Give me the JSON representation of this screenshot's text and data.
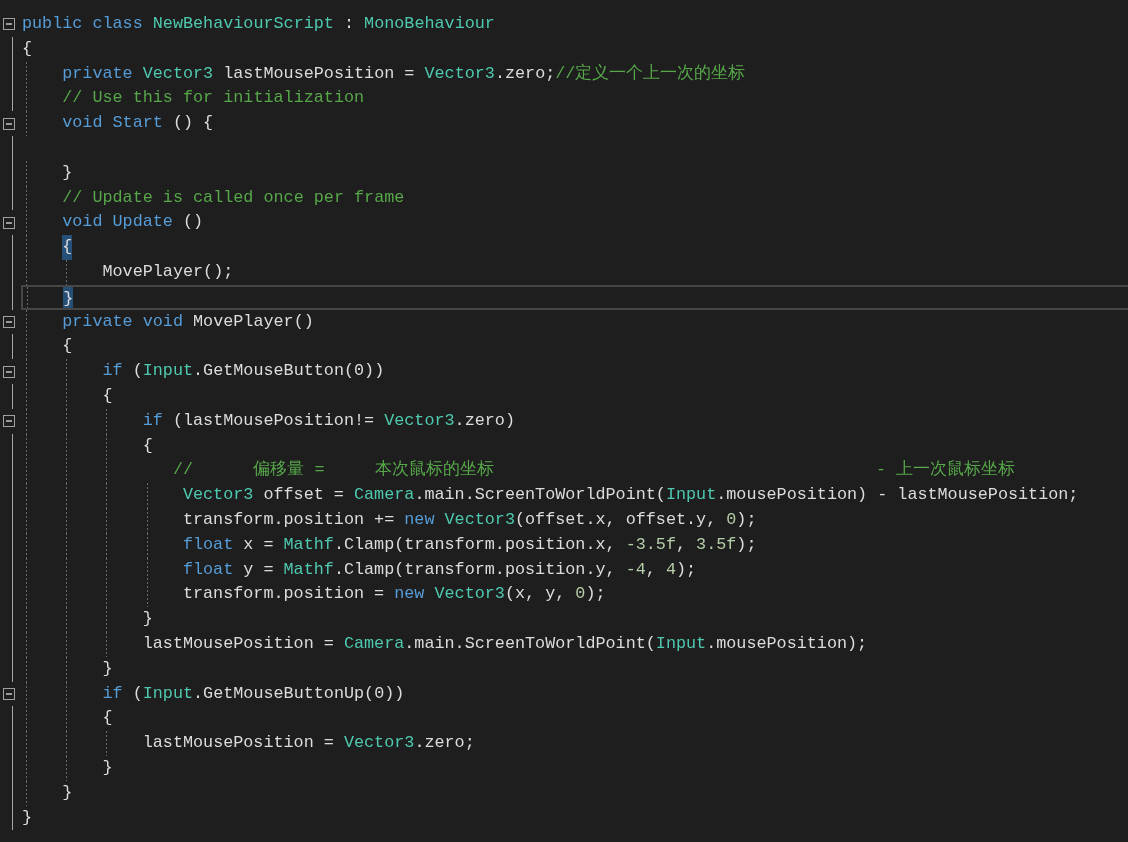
{
  "editor": {
    "lines": [
      {
        "foldable": true,
        "current": false,
        "brace_match": false,
        "tokens": [
          {
            "kind": "kw",
            "text": "public class "
          },
          {
            "kind": "type",
            "text": "NewBehaviourScript"
          },
          {
            "kind": "plain",
            "text": " : "
          },
          {
            "kind": "type",
            "text": "MonoBehaviour"
          }
        ]
      },
      {
        "foldable": false,
        "current": false,
        "brace_match": false,
        "tokens": [
          {
            "kind": "plain",
            "text": "{"
          }
        ]
      },
      {
        "foldable": false,
        "current": false,
        "brace_match": false,
        "tokens": [
          {
            "kind": "kw",
            "text": "    private "
          },
          {
            "kind": "type",
            "text": "Vector3"
          },
          {
            "kind": "plain",
            "text": " lastMousePosition = "
          },
          {
            "kind": "type",
            "text": "Vector3"
          },
          {
            "kind": "plain",
            "text": ".zero;"
          },
          {
            "kind": "comment",
            "text": "//定义一个上一次的坐标"
          }
        ]
      },
      {
        "foldable": false,
        "current": false,
        "brace_match": false,
        "tokens": [
          {
            "kind": "comment",
            "text": "    // Use this for initialization"
          }
        ]
      },
      {
        "foldable": true,
        "current": false,
        "brace_match": false,
        "tokens": [
          {
            "kind": "kw",
            "text": "    void "
          },
          {
            "kind": "fn",
            "text": "Start"
          },
          {
            "kind": "plain",
            "text": " () {"
          }
        ]
      },
      {
        "foldable": false,
        "current": false
      },
      {
        "foldable": false,
        "current": false,
        "brace_match": false,
        "tokens": [
          {
            "kind": "plain",
            "text": "    }"
          }
        ]
      },
      {
        "foldable": false,
        "current": false,
        "brace_match": false,
        "tokens": [
          {
            "kind": "comment",
            "text": "    // Update is called once per frame"
          }
        ]
      },
      {
        "foldable": true,
        "current": false,
        "brace_match": false,
        "tokens": [
          {
            "kind": "kw",
            "text": "    void "
          },
          {
            "kind": "fn",
            "text": "Update"
          },
          {
            "kind": "plain",
            "text": " ()"
          }
        ]
      },
      {
        "foldable": false,
        "current": false,
        "brace_match": true,
        "tokens": [
          {
            "kind": "plain",
            "text": "    {"
          }
        ]
      },
      {
        "foldable": false,
        "current": false,
        "brace_match": false,
        "tokens": [
          {
            "kind": "plain",
            "text": "        MovePlayer();"
          }
        ]
      },
      {
        "foldable": false,
        "current": true,
        "brace_match": true,
        "tokens": [
          {
            "kind": "plain",
            "text": "    }"
          }
        ]
      },
      {
        "foldable": true,
        "current": false,
        "brace_match": false,
        "tokens": [
          {
            "kind": "kw",
            "text": "    private void "
          },
          {
            "kind": "plain",
            "text": "MovePlayer()"
          }
        ]
      },
      {
        "foldable": false,
        "current": false,
        "brace_match": false,
        "tokens": [
          {
            "kind": "plain",
            "text": "    {"
          }
        ]
      },
      {
        "foldable": true,
        "current": false,
        "brace_match": false,
        "tokens": [
          {
            "kind": "kw",
            "text": "        if"
          },
          {
            "kind": "plain",
            "text": " ("
          },
          {
            "kind": "type",
            "text": "Input"
          },
          {
            "kind": "plain",
            "text": ".GetMouseButton(0))"
          }
        ]
      },
      {
        "foldable": false,
        "current": false,
        "brace_match": false,
        "tokens": [
          {
            "kind": "plain",
            "text": "        {"
          }
        ]
      },
      {
        "foldable": true,
        "current": false,
        "brace_match": false,
        "tokens": [
          {
            "kind": "kw",
            "text": "            if"
          },
          {
            "kind": "plain",
            "text": " (lastMousePosition!= "
          },
          {
            "kind": "type",
            "text": "Vector3"
          },
          {
            "kind": "plain",
            "text": ".zero)"
          }
        ]
      },
      {
        "foldable": false,
        "current": false,
        "brace_match": false,
        "tokens": [
          {
            "kind": "plain",
            "text": "            {"
          }
        ]
      },
      {
        "foldable": false,
        "current": false,
        "brace_match": false,
        "tokens": [
          {
            "kind": "comment",
            "text": "               //      偏移量 =     本次鼠标的坐标                                      - 上一次鼠标坐标"
          }
        ]
      },
      {
        "foldable": false,
        "current": false,
        "brace_match": false,
        "tokens": [
          {
            "kind": "type",
            "text": "                Vector3"
          },
          {
            "kind": "plain",
            "text": " offset = "
          },
          {
            "kind": "type",
            "text": "Camera"
          },
          {
            "kind": "plain",
            "text": ".main.ScreenToWorldPoint("
          },
          {
            "kind": "type",
            "text": "Input"
          },
          {
            "kind": "plain",
            "text": ".mousePosition) - lastMousePosition;"
          }
        ]
      },
      {
        "foldable": false,
        "current": false,
        "brace_match": false,
        "tokens": [
          {
            "kind": "plain",
            "text": "                transform.position += "
          },
          {
            "kind": "kw",
            "text": "new "
          },
          {
            "kind": "type",
            "text": "Vector3"
          },
          {
            "kind": "plain",
            "text": "(offset.x, offset.y, "
          },
          {
            "kind": "num",
            "text": "0"
          },
          {
            "kind": "plain",
            "text": ");"
          }
        ]
      },
      {
        "foldable": false,
        "current": false,
        "brace_match": false,
        "tokens": [
          {
            "kind": "kw",
            "text": "                float"
          },
          {
            "kind": "plain",
            "text": " x = "
          },
          {
            "kind": "type",
            "text": "Mathf"
          },
          {
            "kind": "plain",
            "text": ".Clamp(transform.position.x, "
          },
          {
            "kind": "num",
            "text": "-3.5f"
          },
          {
            "kind": "plain",
            "text": ", "
          },
          {
            "kind": "num",
            "text": "3.5f"
          },
          {
            "kind": "plain",
            "text": ");"
          }
        ]
      },
      {
        "foldable": false,
        "current": false,
        "brace_match": false,
        "tokens": [
          {
            "kind": "kw",
            "text": "                float"
          },
          {
            "kind": "plain",
            "text": " y = "
          },
          {
            "kind": "type",
            "text": "Mathf"
          },
          {
            "kind": "plain",
            "text": ".Clamp(transform.position.y, "
          },
          {
            "kind": "num",
            "text": "-4"
          },
          {
            "kind": "plain",
            "text": ", "
          },
          {
            "kind": "num",
            "text": "4"
          },
          {
            "kind": "plain",
            "text": ");"
          }
        ]
      },
      {
        "foldable": false,
        "current": false,
        "brace_match": false,
        "tokens": [
          {
            "kind": "plain",
            "text": "                transform.position = "
          },
          {
            "kind": "kw",
            "text": "new "
          },
          {
            "kind": "type",
            "text": "Vector3"
          },
          {
            "kind": "plain",
            "text": "(x, y, "
          },
          {
            "kind": "num",
            "text": "0"
          },
          {
            "kind": "plain",
            "text": ");"
          }
        ]
      },
      {
        "foldable": false,
        "current": false,
        "brace_match": false,
        "tokens": [
          {
            "kind": "plain",
            "text": "            }"
          }
        ]
      },
      {
        "foldable": false,
        "current": false,
        "brace_match": false,
        "tokens": [
          {
            "kind": "plain",
            "text": "            lastMousePosition = "
          },
          {
            "kind": "type",
            "text": "Camera"
          },
          {
            "kind": "plain",
            "text": ".main.ScreenToWorldPoint("
          },
          {
            "kind": "type",
            "text": "Input"
          },
          {
            "kind": "plain",
            "text": ".mousePosition);"
          }
        ]
      },
      {
        "foldable": false,
        "current": false,
        "brace_match": false,
        "tokens": [
          {
            "kind": "plain",
            "text": "        }"
          }
        ]
      },
      {
        "foldable": true,
        "current": false,
        "brace_match": false,
        "tokens": [
          {
            "kind": "kw",
            "text": "        if"
          },
          {
            "kind": "plain",
            "text": " ("
          },
          {
            "kind": "type",
            "text": "Input"
          },
          {
            "kind": "plain",
            "text": ".GetMouseButtonUp(0))"
          }
        ]
      },
      {
        "foldable": false,
        "current": false,
        "brace_match": false,
        "tokens": [
          {
            "kind": "plain",
            "text": "        {"
          }
        ]
      },
      {
        "foldable": false,
        "current": false,
        "brace_match": false,
        "tokens": [
          {
            "kind": "plain",
            "text": "            lastMousePosition = "
          },
          {
            "kind": "type",
            "text": "Vector3"
          },
          {
            "kind": "plain",
            "text": ".zero;"
          }
        ]
      },
      {
        "foldable": false,
        "current": false,
        "brace_match": false,
        "tokens": [
          {
            "kind": "plain",
            "text": "        }"
          }
        ]
      },
      {
        "foldable": false,
        "current": false,
        "brace_match": false,
        "tokens": [
          {
            "kind": "plain",
            "text": "    }"
          }
        ]
      },
      {
        "foldable": false,
        "current": false,
        "brace_match": false,
        "tokens": [
          {
            "kind": "plain",
            "text": "}"
          }
        ]
      }
    ]
  }
}
